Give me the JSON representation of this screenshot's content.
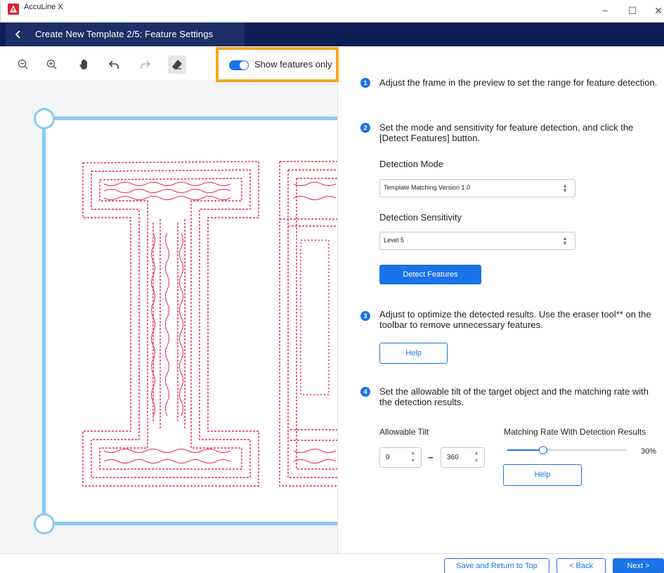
{
  "app": {
    "title": "AccuLine X"
  },
  "window": {
    "minimize": "−",
    "maximize": "☐",
    "close": "✕"
  },
  "header": {
    "title": "Create New Template 2/5: Feature Settings"
  },
  "toolbar": {
    "tools": [
      "zoom-out-icon",
      "zoom-in-icon",
      "hand-icon",
      "undo-icon",
      "redo-icon",
      "eraser-icon"
    ],
    "show_features_label": "Show features only",
    "show_features_on": true
  },
  "steps": [
    {
      "number": "1",
      "text": "Adjust the frame in the preview to set the range for feature detection."
    },
    {
      "number": "2",
      "text": "Set the mode and sensitivity for feature detection, and click the [Detect Features] button."
    },
    {
      "number": "3",
      "text": "Adjust to optimize the detected results. Use the eraser tool** on the toolbar to remove unnecessary features."
    },
    {
      "number": "4",
      "text": "Set the allowable tilt of the target object and the matching rate with the detection results."
    }
  ],
  "detection": {
    "mode_label": "Detection Mode",
    "mode_value": "Template Matching Version 1.0",
    "sensitivity_label": "Detection Sensitivity",
    "sensitivity_value": "Level 5",
    "detect_button": "Detect Features"
  },
  "help_button": "Help",
  "tilt": {
    "label": "Allowable Tilt",
    "min": "0",
    "max": "360",
    "separator": "−"
  },
  "matching": {
    "label": "Matching Rate With Detection Results",
    "value_text": "30%",
    "value": 0.3,
    "help_button": "Help"
  },
  "footer": {
    "save_return": "Save and Return to Top",
    "back": "< Back",
    "next": "Next >"
  },
  "colors": {
    "accent": "#1a73e8",
    "header_bg": "#0d2056",
    "frame": "#89c9f1",
    "feature": "#e8284f",
    "highlight": "#f5a623"
  }
}
